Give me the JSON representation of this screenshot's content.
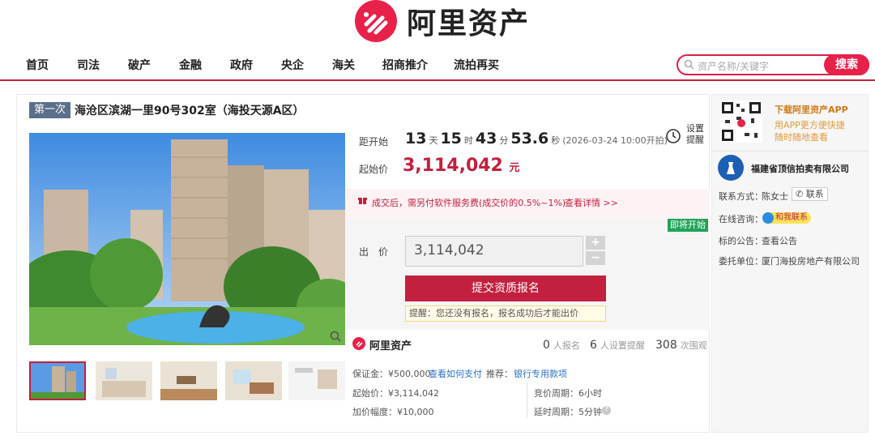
{
  "brand": {
    "name": "阿里资产",
    "accent": "#e8214b"
  },
  "nav": {
    "items": [
      "首页",
      "司法",
      "破产",
      "金融",
      "政府",
      "央企",
      "海关",
      "招商推介",
      "流拍再买"
    ]
  },
  "search": {
    "placeholder": "资产名称/关键字",
    "button": "搜索"
  },
  "auction": {
    "round": "第一次",
    "title": "海沧区滨湖一里90号302室（海投天源A区）",
    "countdown": {
      "label": "距开始",
      "days": "13",
      "days_unit": "天",
      "hours": "15",
      "hours_unit": "时",
      "minutes": "43",
      "minutes_unit": "分",
      "seconds": "53.6",
      "seconds_unit": "秒",
      "start_time": "(2026-03-24 10:00开拍)"
    },
    "reminder": "设置提醒",
    "start_price": {
      "label": "起始价",
      "value": "3,114,042",
      "unit": "元"
    },
    "fee_notice": "成交后，需另付软件服务费(成交价的0.5%~1%)",
    "fee_link": "查看详情 >>",
    "status_tag": "即将开始",
    "bid": {
      "label": "出　价",
      "value": "3,114,042",
      "plus": "+",
      "minus": "−"
    },
    "submit": "提交资质报名",
    "tip": "提醒：您还没有报名，报名成功后才能出价",
    "stats": {
      "registered": "0",
      "registered_label": "人报名",
      "reminders": "6",
      "reminders_label": "人设置提醒",
      "views": "308",
      "views_label": "次围观"
    },
    "details": {
      "deposit": "保证金：¥500,000",
      "deposit_link": "查看如何支付",
      "recommend_label": "推荐：",
      "recommend": "银行专用款项",
      "start_price": "起始价：¥3,114,042",
      "increment": "加价幅度：¥10,000",
      "period": "竞价周期：6小时",
      "delay": "延时周期：5分钟"
    }
  },
  "sidebar": {
    "app_title": "下载阿里资产APP",
    "app_sub1": "用APP更方便快捷",
    "app_sub2": "随时随地查看",
    "company": "福建省顶信拍卖有限公司",
    "contact_label": "联系方式：",
    "contact_name": "陈女士",
    "contact_btn": "联系",
    "online_label": "在线咨询：",
    "online_btn": "和我联系",
    "notice_label": "标的公告：",
    "notice_link": "查看公告",
    "entrust_label": "委托单位：",
    "entrust": "厦门海投房地产有限公司"
  }
}
